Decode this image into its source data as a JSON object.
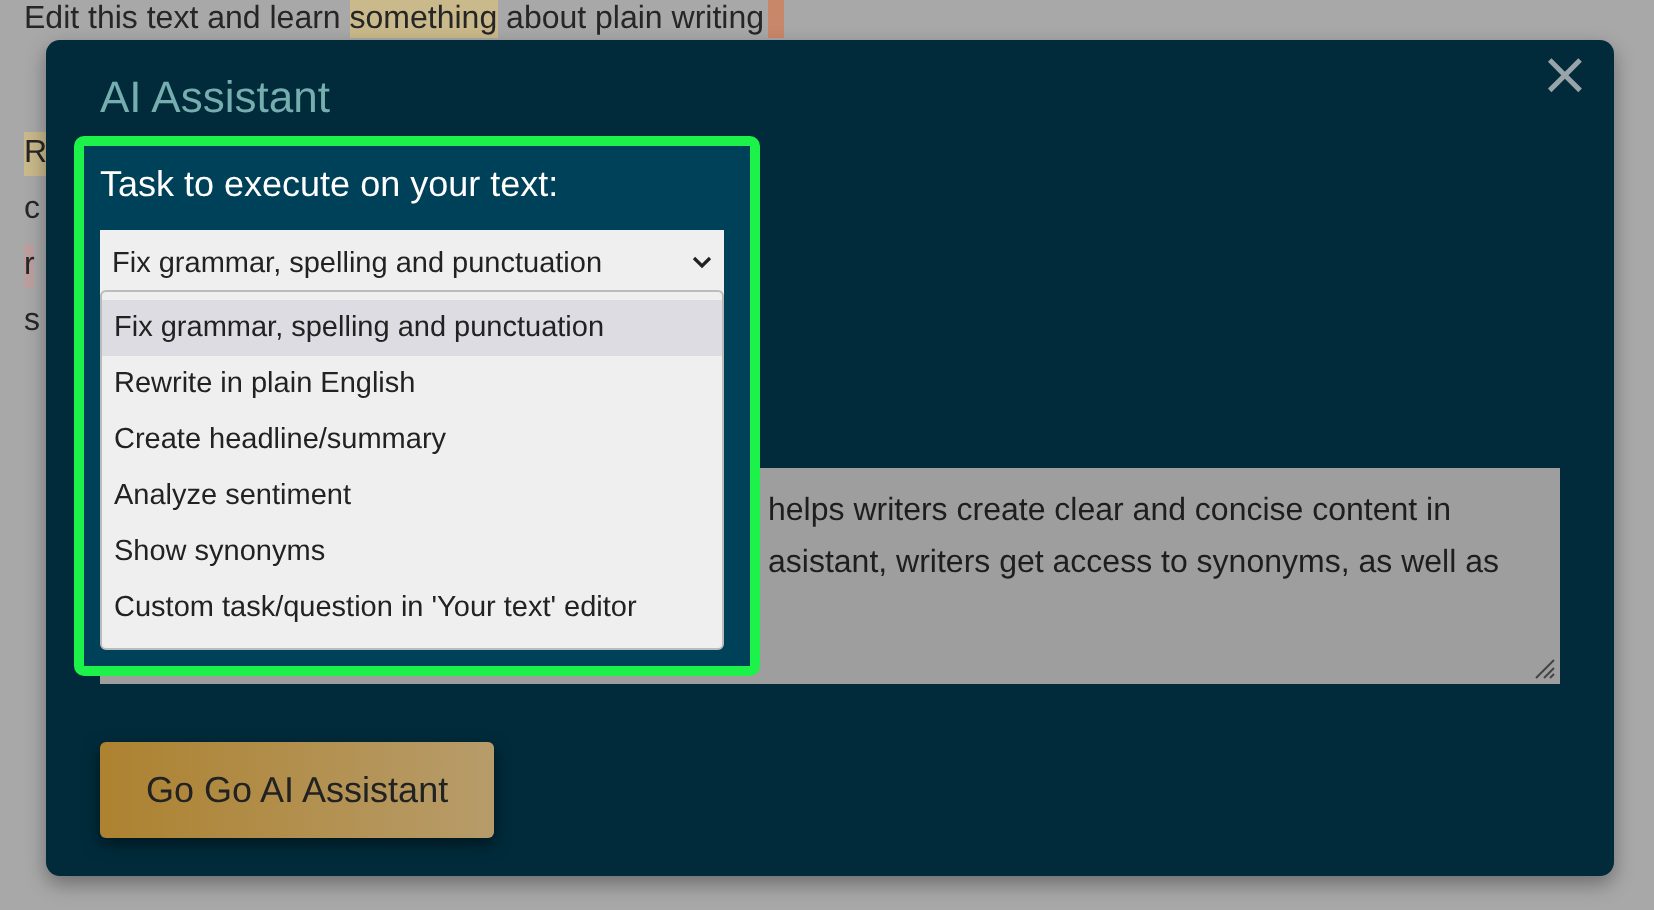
{
  "page": {
    "heading": [
      {
        "text": "Edit this text and learn "
      },
      {
        "text": "something",
        "color": "#c9b98b"
      },
      {
        "text": " about plain writing"
      }
    ],
    "fragments": [
      {
        "text": "R",
        "color": "#c9b98b"
      },
      {
        "text": "c"
      },
      {
        "text": "r",
        "color": "#bd9f9f"
      },
      {
        "text": "s"
      }
    ]
  },
  "dialog": {
    "title": "AI Assistant",
    "close": "×",
    "task": {
      "label": "Task to execute on your text:",
      "value": "Fix grammar, spelling and punctuation",
      "expanded": true,
      "options": [
        {
          "label": "Fix grammar, spelling and punctuation",
          "selected": true
        },
        {
          "label": "Rewrite in plain English",
          "selected": false
        },
        {
          "label": "Create headline/summary",
          "selected": false
        },
        {
          "label": "Analyze sentiment",
          "selected": false
        },
        {
          "label": "Show synonyms",
          "selected": false
        },
        {
          "label": "Custom task/question in 'Your text' editor",
          "selected": false
        }
      ]
    },
    "text_lines": [
      "helps writers create clear and concise content in",
      "asistant, writers get access to synonyms, as well as"
    ],
    "button": "Go Go AI Assistant"
  }
}
